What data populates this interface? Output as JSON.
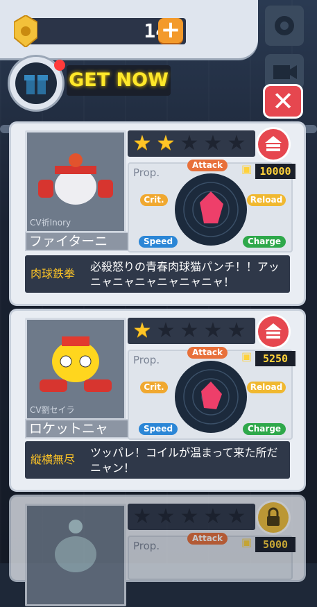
{
  "coins": {
    "value": "140",
    "plus": "+"
  },
  "promo": {
    "label": "GET NOW"
  },
  "buttons": {
    "close": "✕"
  },
  "cards": [
    {
      "cv": "CV祈Inory",
      "name": "ファイターニ",
      "stars_on": 2,
      "stars_total": 5,
      "props_label": "Prop.",
      "cost": "10000",
      "attrs": {
        "attack": "Attack",
        "crit": "Crit.",
        "reload": "Reload",
        "speed": "Speed",
        "charge": "Charge"
      },
      "skill_name": "肉球鉄拳",
      "skill_text": "必殺怒りの青春肉球猫パンチ！！アッニャニャニャニャニャニャ！",
      "action": "unlocked"
    },
    {
      "cv": "CV劉セイラ",
      "name": "ロケットニャ",
      "stars_on": 1,
      "stars_total": 5,
      "props_label": "Prop.",
      "cost": "5250",
      "attrs": {
        "attack": "Attack",
        "crit": "Crit.",
        "reload": "Reload",
        "speed": "Speed",
        "charge": "Charge"
      },
      "skill_name": "縦横無尽",
      "skill_text": "ツッパレ！コイルが温まって来た所だニャン！",
      "action": "unlocked"
    },
    {
      "stars_on": 0,
      "stars_total": 5,
      "props_label": "Prop.",
      "cost": "5000",
      "attrs": {
        "attack": "Attack"
      },
      "action": "locked"
    }
  ],
  "colors": {
    "accent": "#e6474f",
    "star": "#ffc526",
    "attack": "#e8703a",
    "crit": "#f0a830",
    "reload": "#f0b830",
    "speed": "#2b86d6",
    "charge": "#2ea84a"
  }
}
